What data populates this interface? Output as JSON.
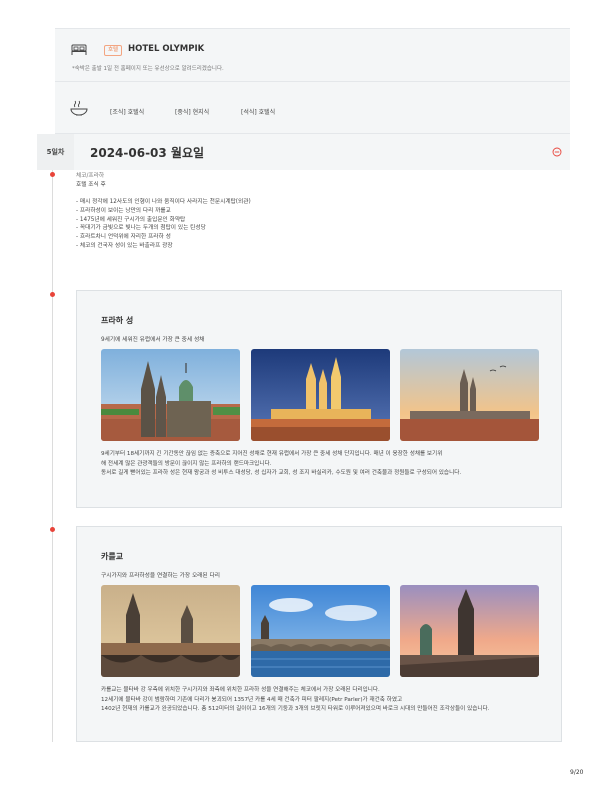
{
  "hotel": {
    "tag": "호텔",
    "name": "HOTEL OLYMPIK",
    "note": "*숙박은 출발 1일 전 홈페이지 또는 유선상으로 알려드리겠습니다."
  },
  "meals": [
    {
      "label": "[조식] 호텔식"
    },
    {
      "label": "[중식] 현지식"
    },
    {
      "label": "[석식] 호텔식"
    }
  ],
  "day": {
    "badge": "5일차",
    "date": "2024-06-03 월요일"
  },
  "schedule": {
    "line1": "체코/프라하",
    "line2": "호텔 조식 후",
    "bullets": [
      "- 매시 정각에 12사도의 인형이 나와 움직이다 사라지는 천문시계탑(외관)",
      "- 프라하성이 보이는 낭만의 다리 까를교",
      "- 1475년에 세워진 구시가의 출입문인 화약탑",
      "- 꼭대기가 금빛으로 빛나는 두개의 첨탑이 있는 틴성당",
      "- 흐라트차니 언덕위에 자리한 프라하 성",
      "- 체코의 건국자 성이 있는 바츨라프 광장"
    ]
  },
  "cards": [
    {
      "title": "프라하 성",
      "subtitle": "9세기에 세워진 유럽에서 가장 큰 중세 성채",
      "desc": [
        "9세기부터 18세기까지 긴 기간동안 끊임 없는 증축으로 지어진 성채로 현재 유럽에서 가장 큰 중세 성채 단지입니다. 매년 이 웅장한 성채를 보기위",
        "해 전세계 많은 관광객들의 방문이 끊이지 않는 프라하의 랜드마크입니다.",
        "동서로 길게 뻗어있는 프라하 성은 현재 왕궁과 성 비투스 대성당, 성 십자가 교회, 성 조지 바실리카, 수도원 및 여러 건축물과 정원들로 구성되어 있습니다."
      ]
    },
    {
      "title": "카를교",
      "subtitle": "구시가지와 프라하성을 연결하는 가장 오래된 다리",
      "desc": [
        "카를교는 블타바 강 우측에 위치한 구시가지와 좌측에 위치한 프라하 성을 연결해주는 체코에서 가장 오래된 다리입니다.",
        "12세기에 블타바 강이 범람하며 기존에 다리가 붕괴되어 1357년 카를 4세 때 건축가 피터 팔레지(Petr Parler)가 재건축 하였고",
        "1402년 현재의 카를교가 완공되었습니다. 총 512미터의 길이이고 16개의 기둥과 3개의 브릿지 타워로 이루어져있으며 바로크 시대의 만들어진 조각상들이 있습니다."
      ]
    }
  ],
  "page": "9/20",
  "colors": {
    "accent": "#e8443a",
    "tag": "#f08a5a",
    "panel": "#f4f6f7"
  }
}
